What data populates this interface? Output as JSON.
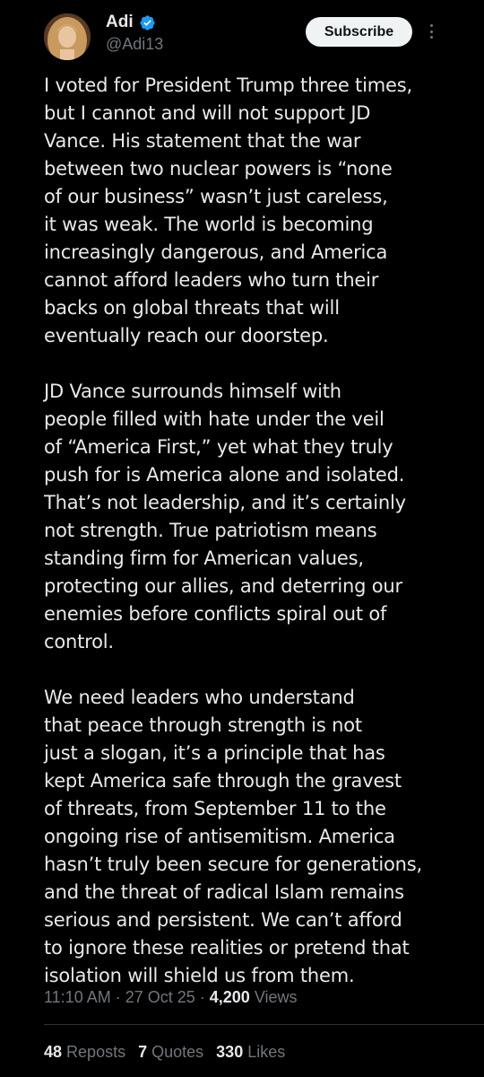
{
  "author": {
    "name": "Adi",
    "handle": "@Adi13",
    "verified": true,
    "avatar": "avatar-photo"
  },
  "actions": {
    "subscribe_label": "Subscribe",
    "more_icon": "more-vertical-icon"
  },
  "post": {
    "paragraphs": [
      "I voted for President Trump three times,\nbut I cannot and will not support JD\nVance. His statement that the war\nbetween two nuclear powers is “none\nof our business” wasn’t just careless,\nit was weak. The world is becoming\nincreasingly dangerous, and America\ncannot afford leaders who turn their\nbacks on global threats that will\neventually reach our doorstep.",
      "JD Vance surrounds himself with\npeople filled with hate under the veil\nof “America First,” yet what they truly\npush for is America alone and isolated.\nThat’s not leadership, and it’s certainly\nnot strength. True patriotism means\nstanding firm for American values,\nprotecting our allies, and deterring our\nenemies before conflicts spiral out of\ncontrol.",
      "We need leaders who understand\nthat peace through strength is not\njust a slogan, it’s a principle that has\nkept America safe through the gravest\nof threats, from September 11 to the\nongoing rise of antisemitism. America\nhasn’t truly been secure for generations,\nand the threat of radical Islam remains\nserious and persistent. We can’t afford\nto ignore these realities or pretend that\nisolation will shield us from them."
    ]
  },
  "meta": {
    "time": "11:10 AM",
    "separator": " · ",
    "date": "27 Oct 25",
    "views_count": "4,200",
    "views_label": "Views"
  },
  "stats": {
    "reposts_count": "48",
    "reposts_label": "Reposts",
    "quotes_count": "7",
    "quotes_label": "Quotes",
    "likes_count": "330",
    "likes_label": "Likes"
  },
  "colors": {
    "background": "#000000",
    "text": "#e7e9ea",
    "secondary_text": "#71767b",
    "verified": "#1d9bf0",
    "button_bg": "#eff3f4"
  }
}
